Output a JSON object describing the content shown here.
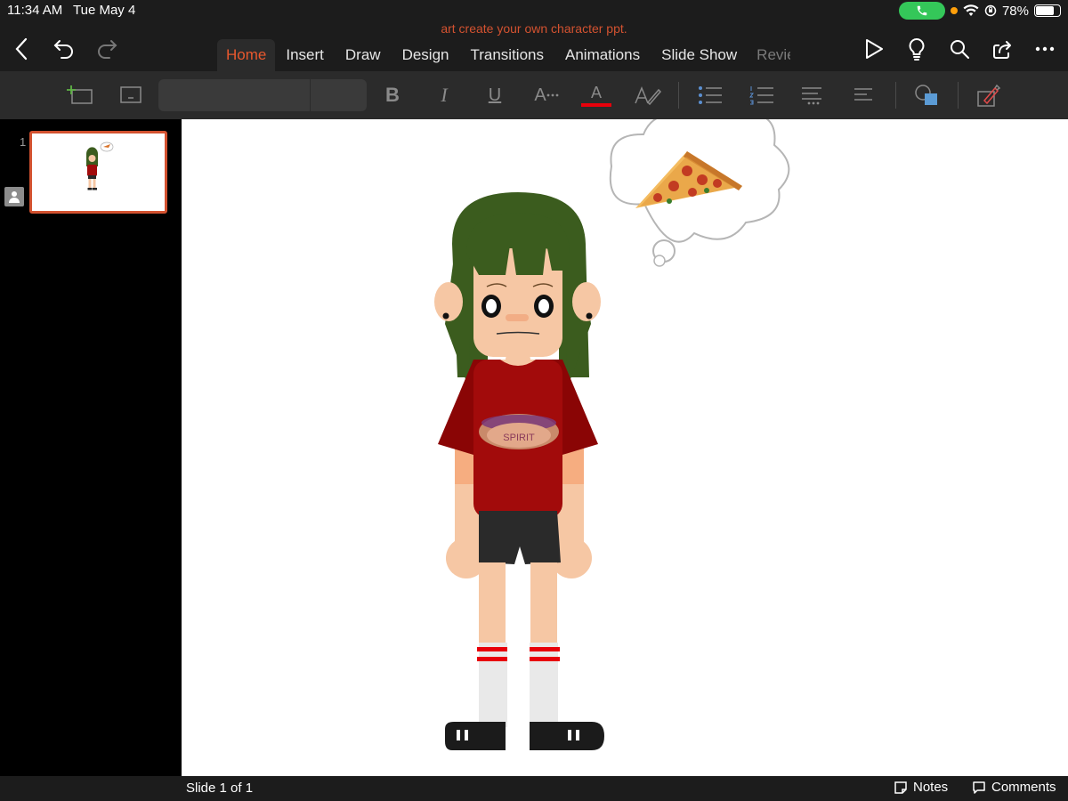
{
  "status": {
    "time": "11:34 AM",
    "date": "Tue May 4",
    "battery_percent": "78%",
    "battery_level": 0.78
  },
  "document": {
    "title": "art create your own character ppt."
  },
  "tabs": [
    {
      "label": "Home",
      "active": true
    },
    {
      "label": "Insert"
    },
    {
      "label": "Draw"
    },
    {
      "label": "Design"
    },
    {
      "label": "Transitions"
    },
    {
      "label": "Animations"
    },
    {
      "label": "Slide Show"
    },
    {
      "label": "Revie"
    }
  ],
  "ribbon": {
    "bold": "B",
    "italic": "I",
    "underline": "U",
    "font_size_glyph": "A",
    "font_color_glyph": "A",
    "font_color": "#e8000b"
  },
  "thumbnails": [
    {
      "number": "1"
    }
  ],
  "slide": {
    "shirt_text": "SPIRIT"
  },
  "footer": {
    "slide_count": "Slide 1 of 1",
    "notes": "Notes",
    "comments": "Comments"
  },
  "colors": {
    "accent": "#d35230",
    "hair": "#3b5c1e",
    "skin": "#f6c7a4",
    "shirt": "#a20b0b",
    "shorts": "#2a2a2a"
  }
}
